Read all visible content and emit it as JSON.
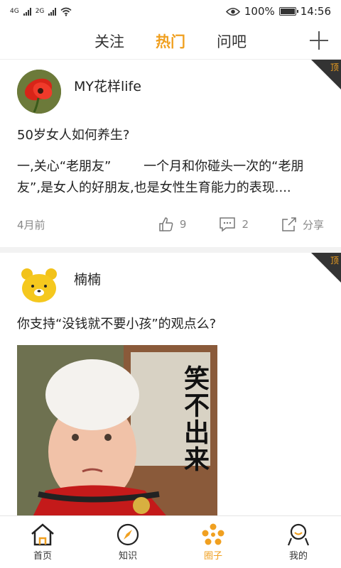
{
  "status_bar": {
    "network_1": "4G",
    "network_2": "2G",
    "battery_percent": "100%",
    "battery_level": 1.0,
    "time": "14:56"
  },
  "top_tabs": {
    "items": [
      {
        "label": "关注",
        "active": false
      },
      {
        "label": "热门",
        "active": true
      },
      {
        "label": "问吧",
        "active": false
      }
    ],
    "add_icon": "plus-icon"
  },
  "posts": [
    {
      "pinned": true,
      "pin_label": "顶",
      "username": "MY花样life",
      "title": "50岁女人如何养生?",
      "excerpt_line1": "一,关心“老朋友”        一个月和你碰头一次的“老朋",
      "excerpt_line2": "友”,是女人的好朋友,也是女性生育能力的表现....",
      "time": "4月前",
      "likes": "9",
      "comments": "2",
      "share_label": "分享"
    },
    {
      "pinned": true,
      "pin_label": "顶",
      "username": "楠楠",
      "title": "你支持“没钱就不要小孩”的观点么?",
      "image_caption": "笑不出来"
    }
  ],
  "bottom_nav": {
    "items": [
      {
        "label": "首页",
        "icon": "home-icon",
        "active": false
      },
      {
        "label": "知识",
        "icon": "compass-icon",
        "active": false
      },
      {
        "label": "圈子",
        "icon": "circle-group-icon",
        "active": true
      },
      {
        "label": "我的",
        "icon": "profile-icon",
        "active": false
      }
    ]
  },
  "colors": {
    "accent": "#f0a020",
    "text": "#222222",
    "muted": "#888888"
  }
}
